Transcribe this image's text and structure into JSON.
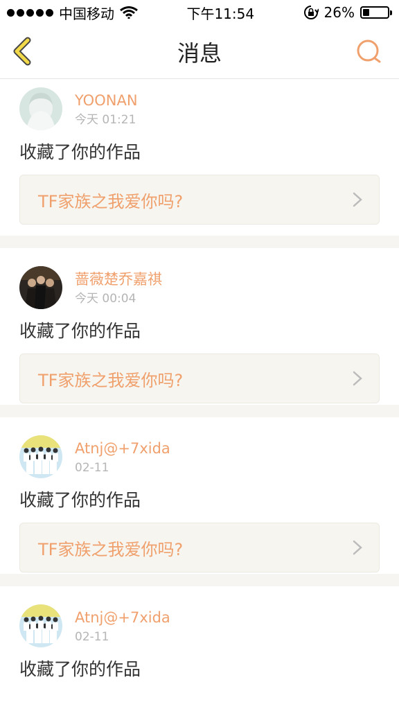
{
  "status_bar": {
    "carrier": "中国移动",
    "time": "下午11:54",
    "battery_percent": "26%",
    "battery_level": 0.26
  },
  "nav": {
    "title": "消息"
  },
  "messages": [
    {
      "user": "YOONAN",
      "time": "今天 01:21",
      "action": "收藏了你的作品",
      "work": "TF家族之我爱你吗?"
    },
    {
      "user": "蔷薇楚乔嘉祺",
      "time": "今天 00:04",
      "action": "收藏了你的作品",
      "work": "TF家族之我爱你吗?"
    },
    {
      "user": "Atnj@+7xida",
      "time": "02-11",
      "action": "收藏了你的作品",
      "work": "TF家族之我爱你吗?"
    },
    {
      "user": "Atnj@+7xida",
      "time": "02-11",
      "action": "收藏了你的作品"
    }
  ],
  "colors": {
    "accent": "#f0a06c",
    "back_arrow": "#f2d94a",
    "link_bg": "#f6f5ef",
    "separator": "#f7f5f2"
  }
}
